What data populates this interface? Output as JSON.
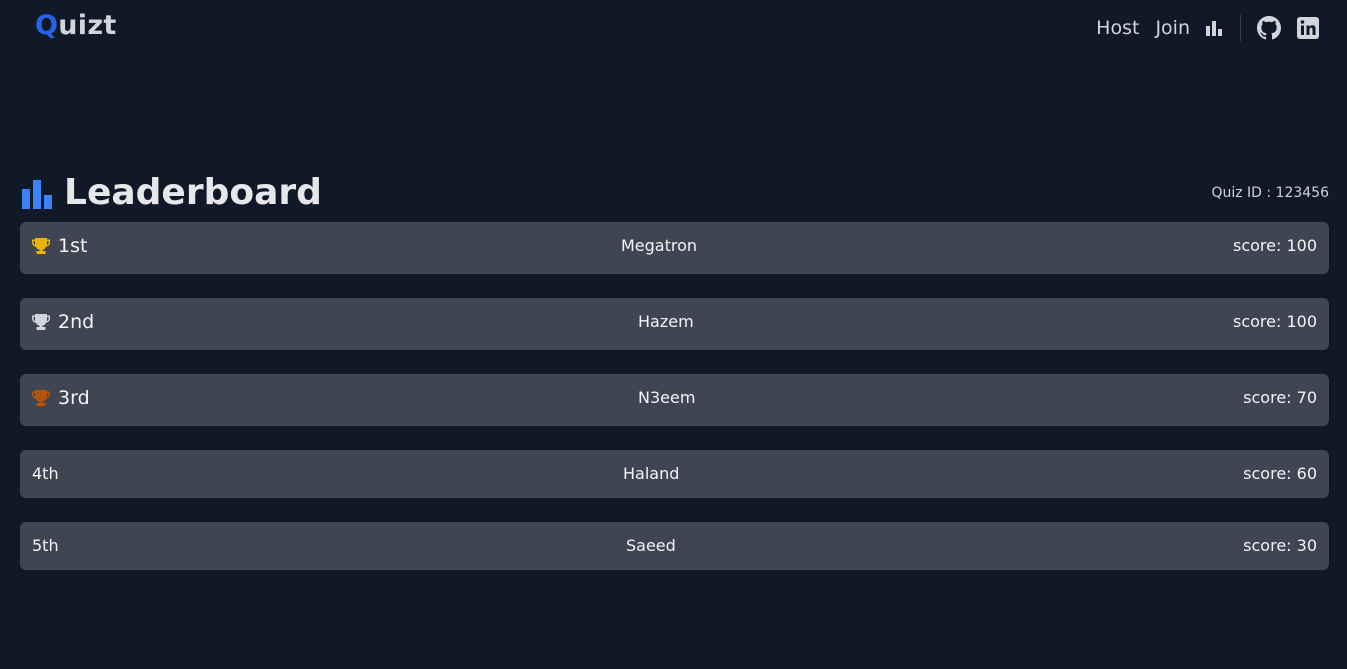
{
  "nav": {
    "logo_first": "Q",
    "logo_rest": "uizt",
    "host_label": "Host",
    "join_label": "Join",
    "icons": [
      "bar-chart-icon",
      "github-icon",
      "linkedin-icon"
    ]
  },
  "page": {
    "title": "Leaderboard",
    "quiz_id": "Quiz ID : 123456"
  },
  "leaderboard": [
    {
      "rank": "1st",
      "name": "Megatron",
      "score": "score: 100",
      "trophy": "gold"
    },
    {
      "rank": "2nd",
      "name": "Hazem",
      "score": "score: 100",
      "trophy": "silver"
    },
    {
      "rank": "3rd",
      "name": "N3eem",
      "score": "score: 70",
      "trophy": "bronze"
    },
    {
      "rank": "4th",
      "name": "Haland",
      "score": "score: 60",
      "trophy": ""
    },
    {
      "rank": "5th",
      "name": "Saeed",
      "score": "score: 30",
      "trophy": ""
    }
  ],
  "colors": {
    "background": "#111827",
    "row": "#3f4552",
    "accent": "#2563eb",
    "gold": "#eab308",
    "silver": "#d1d5db",
    "bronze": "#b45309"
  }
}
